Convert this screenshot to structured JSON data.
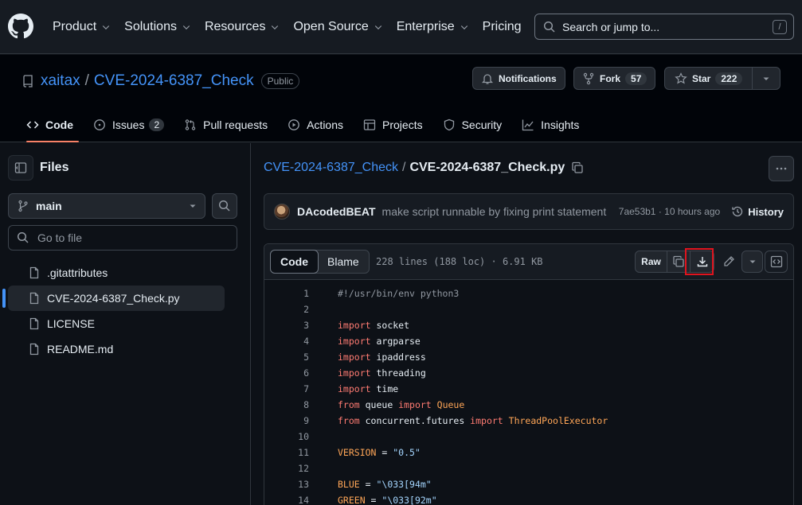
{
  "header": {
    "nav": [
      "Product",
      "Solutions",
      "Resources",
      "Open Source",
      "Enterprise",
      "Pricing"
    ],
    "search_placeholder": "Search or jump to...",
    "search_shortcut": "/"
  },
  "repo": {
    "owner": "xaitax",
    "name": "CVE-2024-6387_Check",
    "visibility": "Public",
    "notifications_label": "Notifications",
    "fork_label": "Fork",
    "fork_count": "57",
    "star_label": "Star",
    "star_count": "222"
  },
  "tabs": [
    {
      "label": "Code",
      "icon": "code-icon"
    },
    {
      "label": "Issues",
      "icon": "issue-icon",
      "count": "2"
    },
    {
      "label": "Pull requests",
      "icon": "pull-request-icon"
    },
    {
      "label": "Actions",
      "icon": "play-icon"
    },
    {
      "label": "Projects",
      "icon": "table-icon"
    },
    {
      "label": "Security",
      "icon": "shield-icon"
    },
    {
      "label": "Insights",
      "icon": "graph-icon"
    }
  ],
  "sidebar": {
    "title": "Files",
    "branch": "main",
    "go_to_file": "Go to file",
    "files": [
      ".gitattributes",
      "CVE-2024-6387_Check.py",
      "LICENSE",
      "README.md"
    ]
  },
  "breadcrumb": {
    "repo": "CVE-2024-6387_Check",
    "separator": "/",
    "file": "CVE-2024-6387_Check.py"
  },
  "commit": {
    "author": "DAcodedBEAT",
    "message": "make script runnable by fixing print statement",
    "meta": "7ae53b1 · 10 hours ago",
    "history_label": "History"
  },
  "code_toolbar": {
    "code_label": "Code",
    "blame_label": "Blame",
    "info": "228 lines (188 loc) · 6.91 KB",
    "raw_label": "Raw"
  },
  "code_lines": [
    {
      "n": "1",
      "t": "#!/usr/bin/env python3"
    },
    {
      "n": "2",
      "t": ""
    },
    {
      "n": "3",
      "t": "import socket"
    },
    {
      "n": "4",
      "t": "import argparse"
    },
    {
      "n": "5",
      "t": "import ipaddress"
    },
    {
      "n": "6",
      "t": "import threading"
    },
    {
      "n": "7",
      "t": "import time"
    },
    {
      "n": "8",
      "t": "from queue import Queue"
    },
    {
      "n": "9",
      "t": "from concurrent.futures import ThreadPoolExecutor"
    },
    {
      "n": "10",
      "t": ""
    },
    {
      "n": "11",
      "t": "VERSION = \"0.5\""
    },
    {
      "n": "12",
      "t": ""
    },
    {
      "n": "13",
      "t": "BLUE = \"\\033[94m\""
    },
    {
      "n": "14",
      "t": "GREEN = \"\\033[92m\""
    }
  ],
  "colors": {
    "accent_blue": "#4493f8",
    "tab_underline": "#f78166",
    "highlight_box": "#e0141e"
  }
}
